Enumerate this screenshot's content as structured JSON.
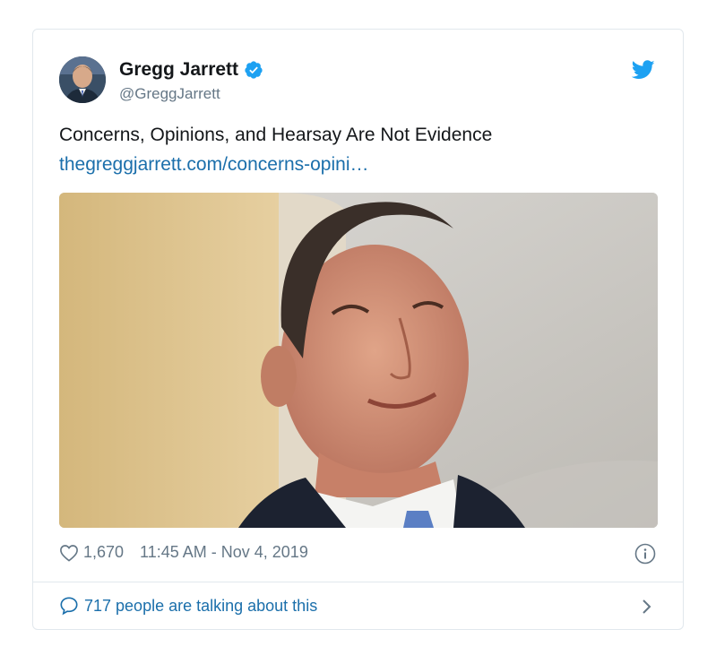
{
  "tweet": {
    "author_name": "Gregg Jarrett",
    "author_handle": "@GreggJarrett",
    "text": "Concerns, Opinions, and Hearsay Are Not Evidence",
    "link_text": "thegreggjarrett.com/concerns-opini…",
    "likes": "1,670",
    "timestamp": "11:45 AM - Nov 4, 2019",
    "talking": "717 people are talking about this"
  },
  "icons": {
    "verified": "verified-badge-icon",
    "brand": "twitter-bird-icon",
    "like": "heart-icon",
    "info": "info-icon",
    "reply": "speech-bubble-icon",
    "more": "chevron-right-icon"
  },
  "colors": {
    "brand": "#1da1f2",
    "link": "#1b6fab",
    "muted": "#657786",
    "border": "#e1e8ed"
  }
}
